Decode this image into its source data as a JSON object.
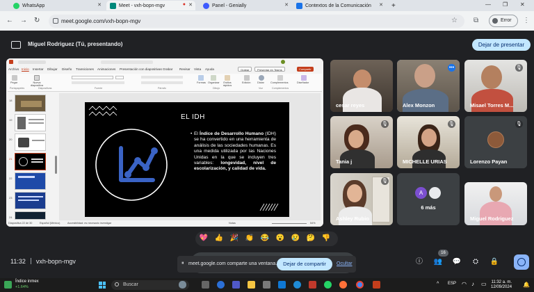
{
  "browser": {
    "tabs": [
      {
        "title": "WhatsApp",
        "color": "#25d366"
      },
      {
        "title": "Meet - vxh-bopn-mgv",
        "color": "#00897b"
      },
      {
        "title": "Panel - Genially",
        "color": "#3d5afe"
      },
      {
        "title": "Contextos de la Comunicación",
        "color": "#1a73e8"
      }
    ],
    "new_tab": "+",
    "url": "meet.google.com/vxh-bopn-mgv",
    "error_label": "Error"
  },
  "banner": {
    "presenter_text": "Miguel Rodriguez (Tú, presentando)",
    "stop_presenting": "Dejar de presentar"
  },
  "ppt": {
    "menu": [
      "Archivo",
      "Inicio",
      "Insertar",
      "Dibujar",
      "Diseño",
      "Transiciones",
      "Animaciones",
      "Presentación con diapositivas",
      "Grabar",
      "Revisar",
      "Vista",
      "Ayuda"
    ],
    "record_btn": "Grabar",
    "present_btn": "Presentar en Teams",
    "share_btn": "Compartir",
    "ribbon_groups": [
      "Portapapeles",
      "Diapositivas",
      "Fuente",
      "Párrafo",
      "Dibujo",
      "Voz",
      "Complementos"
    ],
    "ribbon_items": [
      "Pegar",
      "Nueva diapositiva",
      "Formas",
      "Organizar",
      "Estilos rápidos",
      "Edición",
      "Dictar",
      "Complementos",
      "Diseñador"
    ],
    "thumb_numbers": [
      "18",
      "19",
      "20",
      "21",
      "22",
      "23",
      "24"
    ],
    "status_left": "Diapositiva 22 de 30",
    "status_lang": "Español (México)",
    "status_access": "Accesibilidad: es necesario investigar",
    "status_notes": "Notas",
    "status_zoom": "54%"
  },
  "slide": {
    "title": "EL IDH",
    "bullet": "•",
    "body_pre": "El ",
    "body_bold1": "Índice de Desarrollo Humano",
    "body_mid": " (IDH) se ha convertido en una herramienta de análisis de las sociedades humanas. Es una medida utilizada por las Naciones Unidas en la que se incluyen tres variables: ",
    "body_bold2": "longevidad, nivel de escolarización, y calidad de vida."
  },
  "participants": [
    {
      "name": "cesar reyes",
      "muted": false
    },
    {
      "name": "Alex Monzon",
      "muted": false,
      "speaking": true
    },
    {
      "name": "Misael Torres M...",
      "muted": true
    },
    {
      "name": "Tania j",
      "muted": true
    },
    {
      "name": "MICHELLE URIAS",
      "muted": true
    },
    {
      "name": "Lorenzo Payan",
      "muted": true
    },
    {
      "name": "Ashley Rubio",
      "muted": true
    },
    {
      "name": "6 más",
      "avatar_letter": "A"
    },
    {
      "name": "Miguel Rodriguez",
      "muted": false
    }
  ],
  "reactions": [
    "💖",
    "👍",
    "🎉",
    "👏",
    "😂",
    "😮",
    "😢",
    "🤔",
    "👎"
  ],
  "bottom": {
    "time": "11:32",
    "meeting_code": "vxh-bopn-mgv",
    "share_msg": "meet.google.com comparte una ventana.",
    "stop_sharing": "Dejar de compartir",
    "hide": "Ocultar",
    "people_count": "16"
  },
  "taskbar": {
    "weather_title": "Índice inmex",
    "weather_change": "+1.64%",
    "search_placeholder": "Buscar",
    "time": "11:32 a. m.",
    "date": "12/09/2024",
    "lang": "ESP"
  }
}
